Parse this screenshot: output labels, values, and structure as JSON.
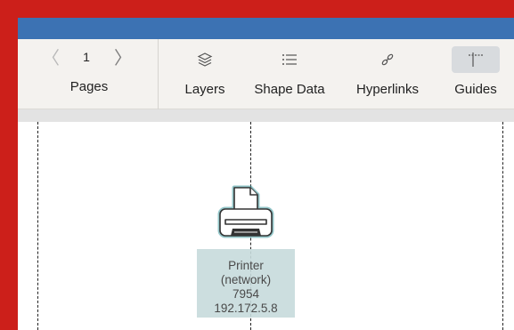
{
  "toolbar": {
    "page_number": "1",
    "pages_label": "Pages",
    "prev_glyph": "〈",
    "next_glyph": "〉",
    "tools": [
      {
        "label": "Layers",
        "icon": "layers-icon"
      },
      {
        "label": "Shape Data",
        "icon": "list-icon"
      },
      {
        "label": "Hyperlinks",
        "icon": "link-icon"
      },
      {
        "label": "Guides",
        "icon": "guides-icon",
        "active": true
      }
    ]
  },
  "canvas": {
    "shape": {
      "icon": "printer-icon",
      "lines": [
        "Printer",
        "(network)",
        "7954",
        "192.172.5.8"
      ]
    }
  },
  "colors": {
    "frame": "#cc1f1a",
    "titlebar": "#3c72b3",
    "toolbar": "#f4f2ef",
    "selection_label": "#c7dadb",
    "selection_outline": "#3e9aa0"
  }
}
